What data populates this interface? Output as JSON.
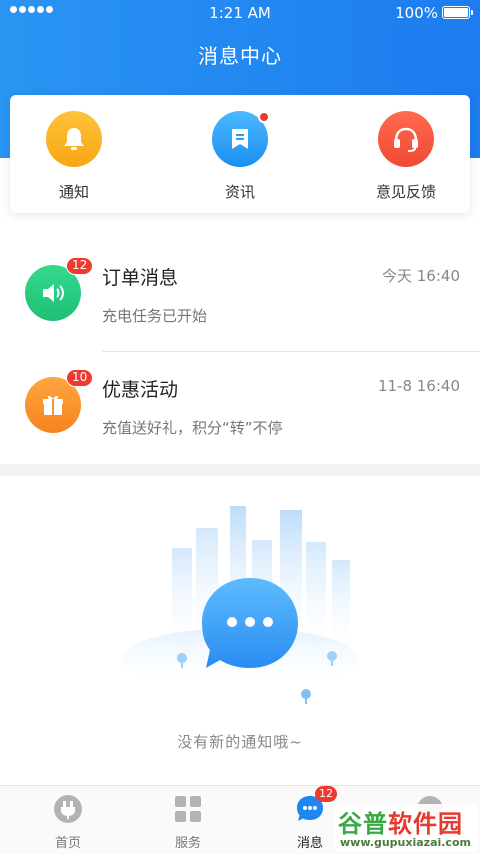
{
  "status_bar": {
    "time": "1:21 AM",
    "battery": "100%"
  },
  "header": {
    "title": "消息中心"
  },
  "quick_actions": [
    {
      "label": "通知",
      "icon": "bell-icon"
    },
    {
      "label": "资讯",
      "icon": "news-icon",
      "has_dot": true
    },
    {
      "label": "意见反馈",
      "icon": "headset-icon"
    }
  ],
  "messages": [
    {
      "title": "订单消息",
      "subtitle": "充电任务已开始",
      "time": "今天 16:40",
      "badge": "12",
      "icon": "speaker-icon",
      "color": "#2ccf83"
    },
    {
      "title": "优惠活动",
      "subtitle": "充值送好礼，积分“转”不停",
      "time": "11-8 16:40",
      "badge": "10",
      "icon": "gift-icon",
      "color": "#f8962e"
    }
  ],
  "empty_state": {
    "text": "没有新的通知哦~"
  },
  "tabs": [
    {
      "label": "首页",
      "icon": "plug-icon"
    },
    {
      "label": "服务",
      "icon": "grid-icon"
    },
    {
      "label": "消息",
      "icon": "chat-bubble-icon",
      "badge": "12",
      "active": true
    },
    {
      "label": "",
      "icon": "user-icon"
    }
  ],
  "watermark": {
    "title_part1": "谷普",
    "title_part2": "软件园",
    "url": "www.gupuxiazai.com"
  },
  "colors": {
    "primary": "#1c7cf0",
    "badge_red": "#ef3b2f",
    "green": "#2ccf83",
    "orange": "#f8962e"
  }
}
